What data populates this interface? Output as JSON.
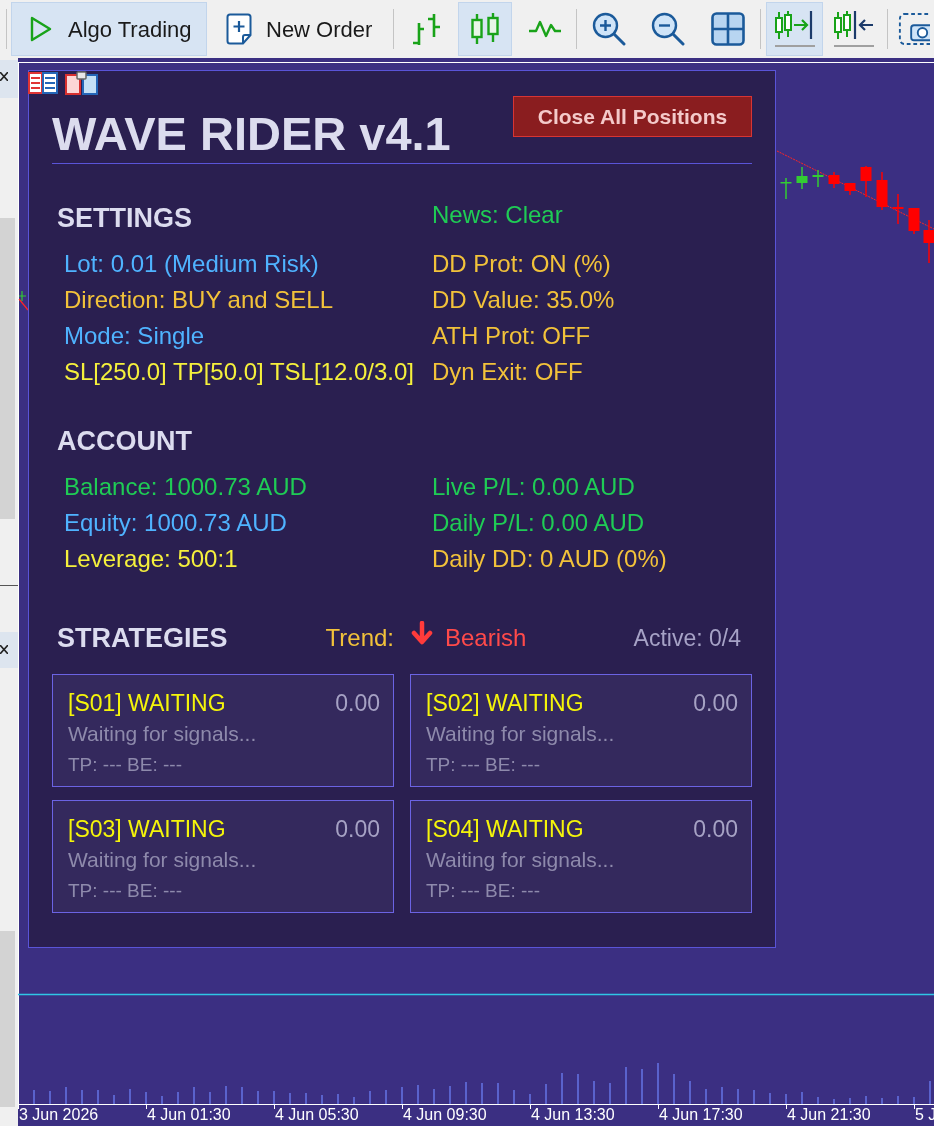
{
  "toolbar": {
    "groups": [
      [
        {
          "kind": "algo",
          "label": "Algo Trading",
          "on": true
        },
        {
          "kind": "order",
          "label": "New Order"
        }
      ],
      [
        {
          "kind": "bars",
          "selected": false
        },
        {
          "kind": "candles",
          "selected": true
        },
        {
          "kind": "line",
          "selected": false
        }
      ],
      [
        {
          "kind": "zoomin"
        },
        {
          "kind": "zoomout"
        },
        {
          "kind": "tile"
        }
      ],
      [
        {
          "kind": "autoscroll",
          "on": true
        },
        {
          "kind": "shift",
          "on": false
        }
      ],
      [
        {
          "kind": "screenshot"
        }
      ]
    ]
  },
  "panel": {
    "title": "WAVE RIDER v4.1",
    "close_button": "Close All Positions",
    "settings": {
      "heading": "SETTINGS",
      "heading_note": {
        "text": "News: Clear",
        "color": "#1fcc55"
      },
      "left": [
        {
          "text": "Lot: 0.01 (Medium Risk)",
          "color": "#4fb3ff"
        },
        {
          "text": "Direction: BUY and SELL",
          "color": "#f2c23a"
        },
        {
          "text": "Mode: Single",
          "color": "#4fb3ff"
        },
        {
          "text": "SL[250.0] TP[50.0] TSL[12.0/3.0]",
          "color": "#f5f03c"
        }
      ],
      "right": [
        {
          "text": "DD Prot: ON (%)",
          "color": "#f2c23a"
        },
        {
          "text": "DD Value: 35.0%",
          "color": "#f2c23a"
        },
        {
          "text": "ATH Prot: OFF",
          "color": "#f2c23a"
        },
        {
          "text": "Dyn Exit: OFF",
          "color": "#f2c23a"
        }
      ]
    },
    "account": {
      "heading": "ACCOUNT",
      "left": [
        {
          "text": "Balance: 1000.73 AUD",
          "color": "#1fcc55"
        },
        {
          "text": "Equity: 1000.73 AUD",
          "color": "#4fb3ff"
        },
        {
          "text": "Leverage: 500:1",
          "color": "#f5f03c"
        }
      ],
      "right": [
        {
          "text": "Live P/L: 0.00 AUD",
          "color": "#1fcc55"
        },
        {
          "text": "Daily P/L: 0.00 AUD",
          "color": "#1fcc55"
        },
        {
          "text": "Daily DD: 0 AUD (0%)",
          "color": "#f2c23a"
        }
      ]
    },
    "strategies": {
      "heading": "STRATEGIES",
      "trend_label": "Trend:",
      "trend": {
        "text": "Bearish",
        "falling": true
      },
      "active": "Active: 0/4",
      "cards": [
        {
          "title": "[S01] WAITING",
          "value": "0.00",
          "status": "Waiting for signals...",
          "targets": "TP: --- BE: ---"
        },
        {
          "title": "[S02] WAITING",
          "value": "0.00",
          "status": "Waiting for signals...",
          "targets": "TP: --- BE: ---"
        },
        {
          "title": "[S03] WAITING",
          "value": "0.00",
          "status": "Waiting for signals...",
          "targets": "TP: --- BE: ---"
        },
        {
          "title": "[S04] WAITING",
          "value": "0.00",
          "status": "Waiting for signals...",
          "targets": "TP: --- BE: ---"
        }
      ]
    }
  },
  "chart": {
    "time_labels": [
      "3 Jun 2026",
      "4 Jun 01:30",
      "4 Jun 05:30",
      "4 Jun 09:30",
      "4 Jun 13:30",
      "4 Jun 17:30",
      "4 Jun 21:30",
      "5 J"
    ]
  }
}
